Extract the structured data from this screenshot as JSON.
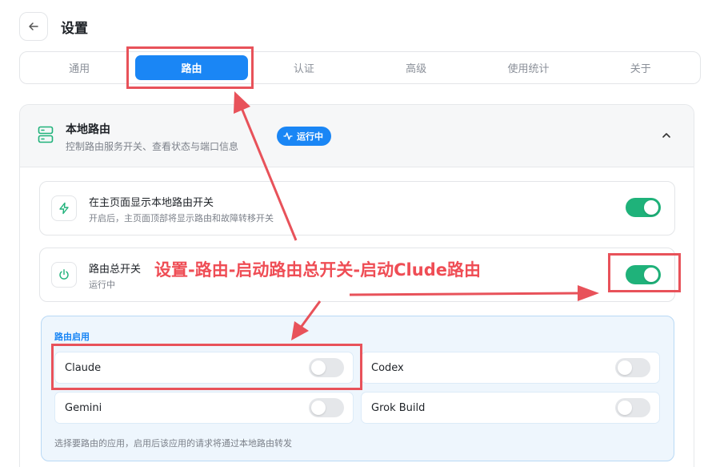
{
  "header": {
    "title": "设置"
  },
  "tabs": [
    {
      "label": "通用"
    },
    {
      "label": "路由"
    },
    {
      "label": "认证"
    },
    {
      "label": "高级"
    },
    {
      "label": "使用统计"
    },
    {
      "label": "关于"
    }
  ],
  "active_tab": "路由",
  "local_route": {
    "title": "本地路由",
    "subtitle": "控制路由服务开关、查看状态与端口信息",
    "badge": "运行中"
  },
  "rows": [
    {
      "title": "在主页面显示本地路由开关",
      "subtitle": "开启后，主页面顶部将显示路由和故障转移开关",
      "enabled": true
    },
    {
      "title": "路由总开关",
      "subtitle": "运行中",
      "enabled": true
    }
  ],
  "routing": {
    "label": "路由启用",
    "items": [
      {
        "name": "Claude",
        "enabled": false
      },
      {
        "name": "Codex",
        "enabled": false
      },
      {
        "name": "Gemini",
        "enabled": false
      },
      {
        "name": "Grok Build",
        "enabled": false
      }
    ],
    "note": "选择要路由的应用，启用后该应用的请求将通过本地路由转发"
  },
  "annotation": {
    "text": "设置-路由-启动路由总开关-启动Clude路由"
  },
  "colors": {
    "accent": "#1a86f5",
    "toggle_on": "#1fb27a",
    "annotation": "#e8525a"
  }
}
